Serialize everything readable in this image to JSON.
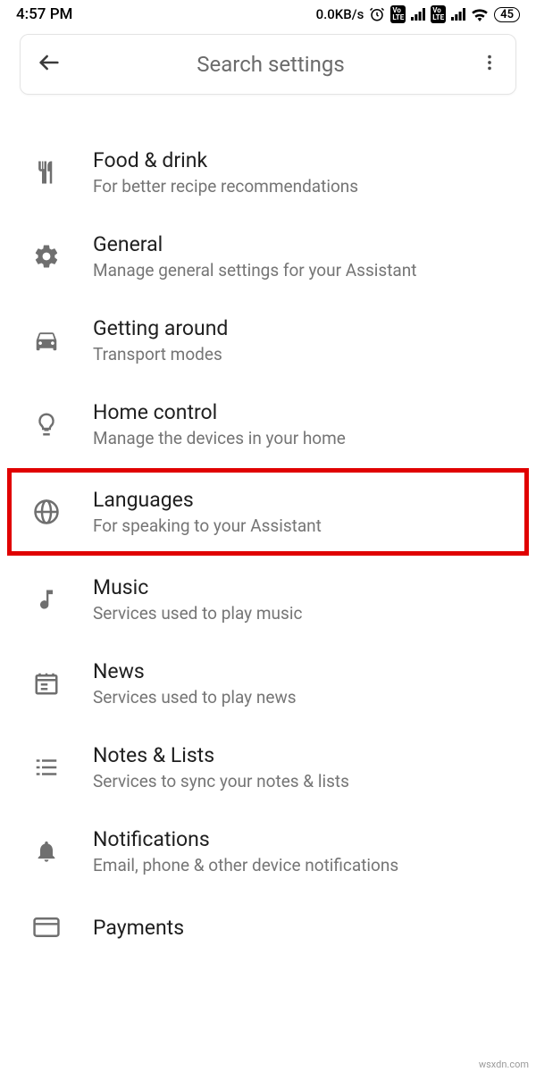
{
  "status": {
    "time": "4:57 PM",
    "net_speed": "0.0KB/s",
    "battery": "45"
  },
  "search": {
    "placeholder": "Search settings"
  },
  "items": [
    {
      "id": "food-drink",
      "title": "Food & drink",
      "sub": "For better recipe recommendations"
    },
    {
      "id": "general",
      "title": "General",
      "sub": "Manage general settings for your Assistant"
    },
    {
      "id": "getting-around",
      "title": "Getting around",
      "sub": "Transport modes"
    },
    {
      "id": "home-control",
      "title": "Home control",
      "sub": "Manage the devices in your home"
    },
    {
      "id": "languages",
      "title": "Languages",
      "sub": "For speaking to your Assistant"
    },
    {
      "id": "music",
      "title": "Music",
      "sub": "Services used to play music"
    },
    {
      "id": "news",
      "title": "News",
      "sub": "Services used to play news"
    },
    {
      "id": "notes-lists",
      "title": "Notes & Lists",
      "sub": "Services to sync your notes & lists"
    },
    {
      "id": "notifications",
      "title": "Notifications",
      "sub": "Email, phone & other device notifications"
    },
    {
      "id": "payments",
      "title": "Payments",
      "sub": ""
    }
  ],
  "watermark": "wsxdn.com"
}
